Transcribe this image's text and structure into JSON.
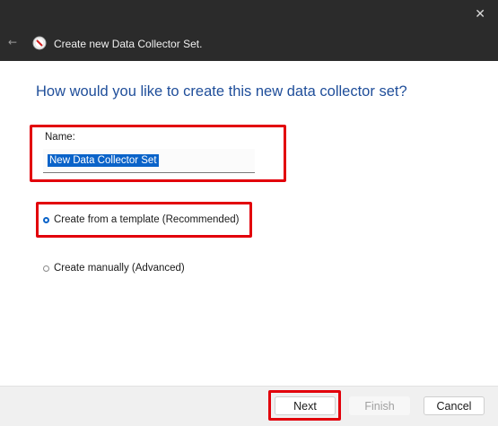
{
  "window": {
    "title": "Create new Data Collector Set.",
    "close_icon": "close-icon",
    "back_icon": "back-arrow-icon",
    "app_icon": "performance-monitor-icon"
  },
  "page": {
    "heading": "How would you like to create this new data collector set?"
  },
  "name_field": {
    "label": "Name:",
    "value": "New Data Collector Set"
  },
  "options": [
    {
      "label": "Create from a template (Recommended)",
      "selected": true
    },
    {
      "label": "Create manually (Advanced)",
      "selected": false
    }
  ],
  "buttons": {
    "next": "Next",
    "finish": "Finish",
    "cancel": "Cancel"
  },
  "colors": {
    "titlebar": "#2b2b2b",
    "heading": "#1f4e9a",
    "highlight_box": "#e2000b",
    "selection": "#0a63c9"
  }
}
